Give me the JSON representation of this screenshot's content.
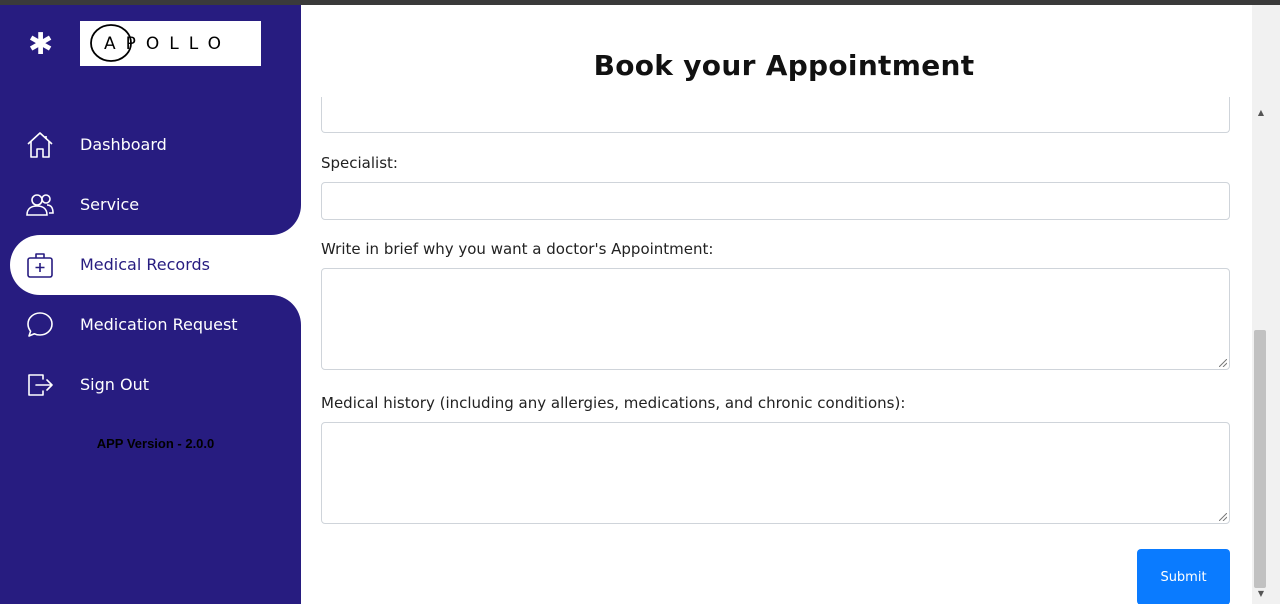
{
  "app": {
    "logo_text": "APOLLO",
    "version": "APP Version - 2.0.0",
    "accent_color": "#271c80",
    "button_color": "#0a7bff"
  },
  "sidebar": {
    "items": [
      {
        "label": "Dashboard",
        "icon": "home-icon"
      },
      {
        "label": "Service",
        "icon": "users-icon"
      },
      {
        "label": "Medical Records",
        "icon": "medical-case-icon",
        "active": true
      },
      {
        "label": "Medication Request",
        "icon": "chat-bubble-icon"
      },
      {
        "label": "Sign Out",
        "icon": "sign-out-icon"
      }
    ]
  },
  "main": {
    "title": "Book your Appointment",
    "fields": {
      "specialist_label": "Specialist:",
      "reason_label": "Write in brief why you want a doctor's Appointment:",
      "history_label": "Medical history (including any allergies, medications, and chronic conditions):"
    },
    "submit_label": "Submit"
  }
}
